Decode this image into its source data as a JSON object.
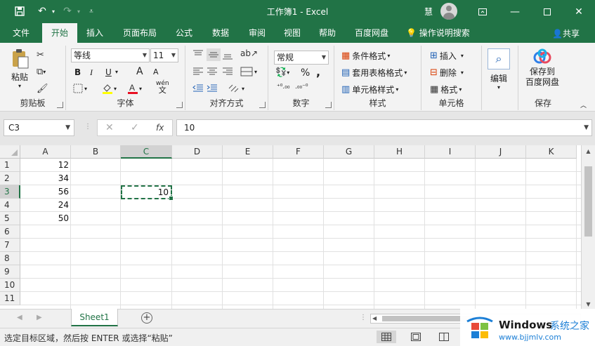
{
  "titlebar": {
    "title": "工作簿1  -  Excel",
    "user": "慧",
    "customize_icon": "customize-qa-icon"
  },
  "tabs": [
    {
      "label": "文件",
      "active": false
    },
    {
      "label": "开始",
      "active": true
    },
    {
      "label": "插入",
      "active": false
    },
    {
      "label": "页面布局",
      "active": false
    },
    {
      "label": "公式",
      "active": false
    },
    {
      "label": "数据",
      "active": false
    },
    {
      "label": "审阅",
      "active": false
    },
    {
      "label": "视图",
      "active": false
    },
    {
      "label": "帮助",
      "active": false
    },
    {
      "label": "百度网盘",
      "active": false
    }
  ],
  "tell_me": "操作说明搜索",
  "share": "共享",
  "ribbon": {
    "clipboard": {
      "label": "剪贴板",
      "paste": "粘贴"
    },
    "font": {
      "label": "字体",
      "font_name": "等线",
      "font_size": "11",
      "bold": "B",
      "italic": "I",
      "underline": "U",
      "grow": "A",
      "shrink": "A",
      "wen": "wén"
    },
    "alignment": {
      "label": "对齐方式"
    },
    "number": {
      "label": "数字",
      "format": "常规",
      "percent": "%",
      "comma": ","
    },
    "styles": {
      "label": "样式",
      "cond_format": "条件格式",
      "table_format": "套用表格格式",
      "cell_style": "单元格样式"
    },
    "cells": {
      "label": "单元格",
      "insert": "插入",
      "delete": "删除",
      "format": "格式"
    },
    "editing": {
      "label": "编辑"
    },
    "save": {
      "label": "保存",
      "btn_line1": "保存到",
      "btn_line2": "百度网盘"
    }
  },
  "formula_bar": {
    "name_box": "C3",
    "fx": "fx",
    "formula": "10"
  },
  "grid": {
    "columns": [
      "A",
      "B",
      "C",
      "D",
      "E",
      "F",
      "G",
      "H",
      "I",
      "J",
      "K"
    ],
    "rows": [
      "1",
      "2",
      "3",
      "4",
      "5",
      "6",
      "7",
      "8",
      "9",
      "10",
      "11"
    ],
    "column_a_values": [
      "12",
      "34",
      "56",
      "24",
      "50"
    ],
    "selected_value": "10"
  },
  "sheet_tab": "Sheet1",
  "status_message": "选定目标区域，然后按 ENTER 或选择“粘贴”",
  "watermark": {
    "brand": "Windows",
    "brand2": "系统之家",
    "url": "www.bjjmlv.com"
  },
  "colors": {
    "accent": "#217346",
    "ribbon_bg": "#f3f3f3",
    "selection": "#217346"
  }
}
